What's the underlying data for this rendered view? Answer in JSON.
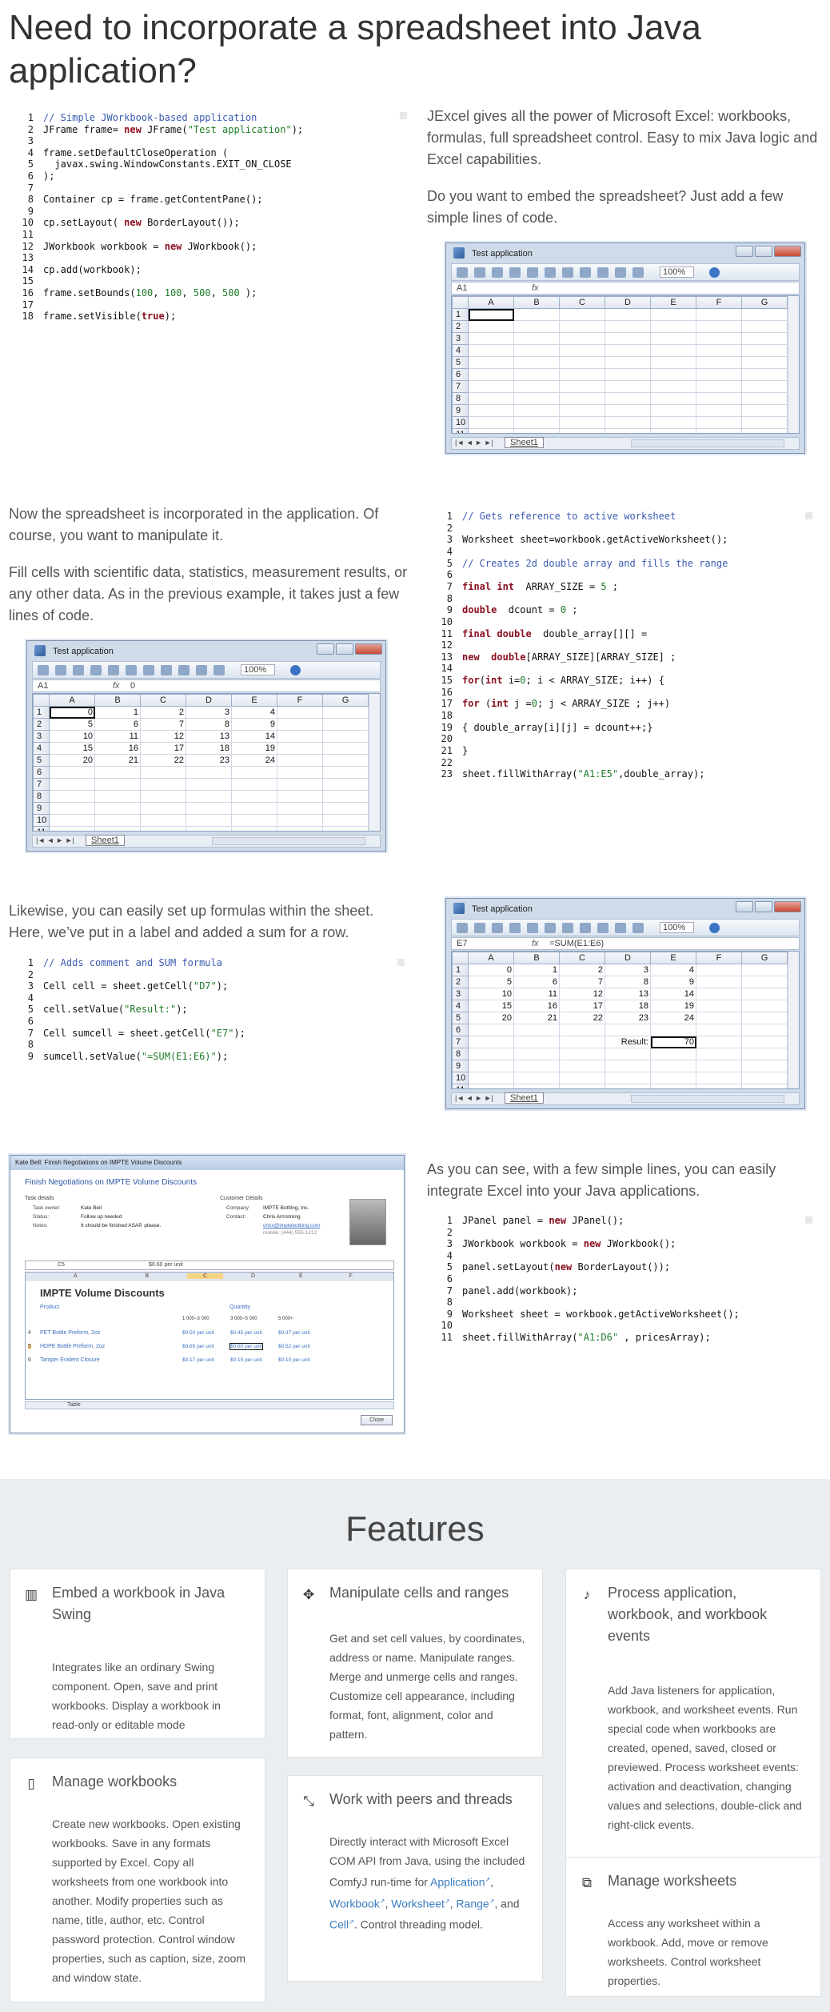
{
  "page_title": "Need to incorporate a spreadsheet into Java application?",
  "s1": {
    "code": [
      {
        "n": "1",
        "parts": [
          [
            "c-com",
            "// Simple JWorkbook-based application"
          ]
        ]
      },
      {
        "n": "2",
        "parts": [
          [
            "",
            "JFrame frame= "
          ],
          [
            "c-kw",
            "new"
          ],
          [
            "",
            " JFrame("
          ],
          [
            "c-str",
            "\"Test application\""
          ],
          [
            "",
            ");"
          ]
        ]
      },
      {
        "n": "3",
        "parts": []
      },
      {
        "n": "4",
        "parts": [
          [
            "",
            "frame.setDefaultCloseOperation ("
          ]
        ]
      },
      {
        "n": "5",
        "parts": [
          [
            "",
            "  javax.swing.WindowConstants.EXIT_ON_CLOSE"
          ]
        ]
      },
      {
        "n": "6",
        "parts": [
          [
            "",
            ");"
          ]
        ]
      },
      {
        "n": "7",
        "parts": []
      },
      {
        "n": "8",
        "parts": [
          [
            "",
            "Container cp = frame.getContentPane();"
          ]
        ]
      },
      {
        "n": "9",
        "parts": []
      },
      {
        "n": "10",
        "parts": [
          [
            "",
            "cp.setLayout( "
          ],
          [
            "c-kw",
            "new"
          ],
          [
            "",
            " BorderLayout());"
          ]
        ]
      },
      {
        "n": "11",
        "parts": []
      },
      {
        "n": "12",
        "parts": [
          [
            "",
            "JWorkbook workbook = "
          ],
          [
            "c-kw",
            "new"
          ],
          [
            "",
            " JWorkbook();"
          ]
        ]
      },
      {
        "n": "13",
        "parts": []
      },
      {
        "n": "14",
        "parts": [
          [
            "",
            "cp.add(workbook);"
          ]
        ]
      },
      {
        "n": "15",
        "parts": []
      },
      {
        "n": "16",
        "parts": [
          [
            "",
            "frame.setBounds("
          ],
          [
            "c-num",
            "100"
          ],
          [
            "",
            ", "
          ],
          [
            "c-num",
            "100"
          ],
          [
            "",
            ", "
          ],
          [
            "c-num",
            "500"
          ],
          [
            "",
            ", "
          ],
          [
            "c-num",
            "500"
          ],
          [
            "",
            " );"
          ]
        ]
      },
      {
        "n": "17",
        "parts": []
      },
      {
        "n": "18",
        "parts": [
          [
            "",
            "frame.setVisible("
          ],
          [
            "c-kw",
            "true"
          ],
          [
            "",
            ");"
          ]
        ]
      }
    ],
    "p1": "JExcel gives all the power of Microsoft Excel: workbooks, formulas, full spreadsheet control. Easy to mix Java logic and Excel capabilities.",
    "p2": "Do you want to embed the spreadsheet? Just add a few simple lines of code."
  },
  "win1": {
    "title": "Test application",
    "cellref": "A1",
    "fx": "fx",
    "formula": "",
    "zoom": "100%",
    "sheet": "Sheet1",
    "cols": [
      "A",
      "B",
      "C",
      "D",
      "E",
      "F",
      "G"
    ],
    "rows": [
      [
        "1",
        "",
        "",
        "",
        "",
        "",
        "",
        ""
      ],
      [
        "2",
        "",
        "",
        "",
        "",
        "",
        "",
        ""
      ],
      [
        "3",
        "",
        "",
        "",
        "",
        "",
        "",
        ""
      ],
      [
        "4",
        "",
        "",
        "",
        "",
        "",
        "",
        ""
      ],
      [
        "5",
        "",
        "",
        "",
        "",
        "",
        "",
        ""
      ],
      [
        "6",
        "",
        "",
        "",
        "",
        "",
        "",
        ""
      ],
      [
        "7",
        "",
        "",
        "",
        "",
        "",
        "",
        ""
      ],
      [
        "8",
        "",
        "",
        "",
        "",
        "",
        "",
        ""
      ],
      [
        "9",
        "",
        "",
        "",
        "",
        "",
        "",
        ""
      ],
      [
        "10",
        "",
        "",
        "",
        "",
        "",
        "",
        ""
      ],
      [
        "11",
        "",
        "",
        "",
        "",
        "",
        "",
        ""
      ]
    ]
  },
  "s2": {
    "p1": "Now the spreadsheet is incorporated in the application. Of course, you want to manipulate it.",
    "p2": "Fill cells with scientific data, statistics, measurement results, or any other data. As in the previous example, it takes just a few lines of code.",
    "code": [
      {
        "n": "1",
        "parts": [
          [
            "c-com",
            "// Gets reference to active worksheet"
          ]
        ]
      },
      {
        "n": "2",
        "parts": []
      },
      {
        "n": "3",
        "parts": [
          [
            "",
            "Worksheet sheet=workbook.getActiveWorksheet();"
          ]
        ]
      },
      {
        "n": "4",
        "parts": []
      },
      {
        "n": "5",
        "parts": [
          [
            "c-com",
            "// Creates 2d double array and fills the range"
          ]
        ]
      },
      {
        "n": "6",
        "parts": []
      },
      {
        "n": "7",
        "parts": [
          [
            "c-kw",
            "final int"
          ],
          [
            "",
            "  ARRAY_SIZE = "
          ],
          [
            "c-num",
            "5"
          ],
          [
            "",
            " ;"
          ]
        ]
      },
      {
        "n": "8",
        "parts": []
      },
      {
        "n": "9",
        "parts": [
          [
            "c-kw",
            "double"
          ],
          [
            "",
            "  dcount = "
          ],
          [
            "c-num",
            "0"
          ],
          [
            "",
            " ;"
          ]
        ]
      },
      {
        "n": "10",
        "parts": []
      },
      {
        "n": "11",
        "parts": [
          [
            "c-kw",
            "final double"
          ],
          [
            "",
            "  double_array[][] ="
          ]
        ]
      },
      {
        "n": "12",
        "parts": []
      },
      {
        "n": "13",
        "parts": [
          [
            "c-kw",
            "new"
          ],
          [
            "",
            "  "
          ],
          [
            "c-kw",
            "double"
          ],
          [
            "",
            "[ARRAY_SIZE][ARRAY_SIZE] ;"
          ]
        ]
      },
      {
        "n": "14",
        "parts": []
      },
      {
        "n": "15",
        "parts": [
          [
            "c-kw",
            "for"
          ],
          [
            "",
            "("
          ],
          [
            "c-kw",
            "int"
          ],
          [
            "",
            " i="
          ],
          [
            "c-num",
            "0"
          ],
          [
            "",
            "; i < ARRAY_SIZE; i++) {"
          ]
        ]
      },
      {
        "n": "16",
        "parts": []
      },
      {
        "n": "17",
        "parts": [
          [
            "c-kw",
            "for"
          ],
          [
            "",
            " ("
          ],
          [
            "c-kw",
            "int"
          ],
          [
            "",
            " j ="
          ],
          [
            "c-num",
            "0"
          ],
          [
            "",
            "; j < ARRAY_SIZE ; j++)"
          ]
        ]
      },
      {
        "n": "18",
        "parts": []
      },
      {
        "n": "19",
        "parts": [
          [
            "",
            "{ double_array[i][j] = dcount++;}"
          ]
        ]
      },
      {
        "n": "20",
        "parts": []
      },
      {
        "n": "21",
        "parts": [
          [
            "",
            "}"
          ]
        ]
      },
      {
        "n": "22",
        "parts": []
      },
      {
        "n": "23",
        "parts": [
          [
            "",
            "sheet.fillWithArray("
          ],
          [
            "c-str",
            "\"A1:E5\""
          ],
          [
            "",
            ",double_array);"
          ]
        ]
      }
    ]
  },
  "win2": {
    "title": "Test application",
    "cellref": "A1",
    "fx": "fx",
    "formula": "0",
    "zoom": "100%",
    "sheet": "Sheet1",
    "cols": [
      "A",
      "B",
      "C",
      "D",
      "E",
      "F",
      "G"
    ],
    "rows": [
      [
        "1",
        "0",
        "1",
        "2",
        "3",
        "4",
        "",
        ""
      ],
      [
        "2",
        "5",
        "6",
        "7",
        "8",
        "9",
        "",
        ""
      ],
      [
        "3",
        "10",
        "11",
        "12",
        "13",
        "14",
        "",
        ""
      ],
      [
        "4",
        "15",
        "16",
        "17",
        "18",
        "19",
        "",
        ""
      ],
      [
        "5",
        "20",
        "21",
        "22",
        "23",
        "24",
        "",
        ""
      ],
      [
        "6",
        "",
        "",
        "",
        "",
        "",
        "",
        ""
      ],
      [
        "7",
        "",
        "",
        "",
        "",
        "",
        "",
        ""
      ],
      [
        "8",
        "",
        "",
        "",
        "",
        "",
        "",
        ""
      ],
      [
        "9",
        "",
        "",
        "",
        "",
        "",
        "",
        ""
      ],
      [
        "10",
        "",
        "",
        "",
        "",
        "",
        "",
        ""
      ],
      [
        "11",
        "",
        "",
        "",
        "",
        "",
        "",
        ""
      ]
    ]
  },
  "s3": {
    "p1": "Likewise, you can easily set up formulas within the sheet. Here, we’ve put in a label and added a sum for a row.",
    "code": [
      {
        "n": "1",
        "parts": [
          [
            "c-com",
            "// Adds comment and SUM formula"
          ]
        ]
      },
      {
        "n": "2",
        "parts": []
      },
      {
        "n": "3",
        "parts": [
          [
            "",
            "Cell cell = sheet.getCell("
          ],
          [
            "c-str",
            "\"D7\""
          ],
          [
            "",
            ");"
          ]
        ]
      },
      {
        "n": "4",
        "parts": []
      },
      {
        "n": "5",
        "parts": [
          [
            "",
            "cell.setValue("
          ],
          [
            "c-str",
            "\"Result:\""
          ],
          [
            "",
            ");"
          ]
        ]
      },
      {
        "n": "6",
        "parts": []
      },
      {
        "n": "7",
        "parts": [
          [
            "",
            "Cell sumcell = sheet.getCell("
          ],
          [
            "c-str",
            "\"E7\""
          ],
          [
            "",
            ");"
          ]
        ]
      },
      {
        "n": "8",
        "parts": []
      },
      {
        "n": "9",
        "parts": [
          [
            "",
            "sumcell.setValue("
          ],
          [
            "c-str",
            "\"=SUM(E1:E6)\""
          ],
          [
            "",
            ");"
          ]
        ]
      }
    ]
  },
  "win3": {
    "title": "Test application",
    "cellref": "E7",
    "fx": "fx",
    "formula": "=SUM(E1:E6)",
    "zoom": "100%",
    "sheet": "Sheet1",
    "cols": [
      "A",
      "B",
      "C",
      "D",
      "E",
      "F",
      "G"
    ],
    "rows": [
      [
        "1",
        "0",
        "1",
        "2",
        "3",
        "4",
        "",
        ""
      ],
      [
        "2",
        "5",
        "6",
        "7",
        "8",
        "9",
        "",
        ""
      ],
      [
        "3",
        "10",
        "11",
        "12",
        "13",
        "14",
        "",
        ""
      ],
      [
        "4",
        "15",
        "16",
        "17",
        "18",
        "19",
        "",
        ""
      ],
      [
        "5",
        "20",
        "21",
        "22",
        "23",
        "24",
        "",
        ""
      ],
      [
        "6",
        "",
        "",
        "",
        "",
        "",
        "",
        ""
      ],
      [
        "7",
        "",
        "",
        "",
        "Result:",
        "70",
        "",
        ""
      ],
      [
        "8",
        "",
        "",
        "",
        "",
        "",
        "",
        ""
      ],
      [
        "9",
        "",
        "",
        "",
        "",
        "",
        "",
        ""
      ],
      [
        "10",
        "",
        "",
        "",
        "",
        "",
        "",
        ""
      ],
      [
        "11",
        "",
        "",
        "",
        "",
        "",
        "",
        ""
      ]
    ]
  },
  "s4": {
    "p1": "As you can see, with a few simple lines, you can easily integrate Excel into your Java applications.",
    "code": [
      {
        "n": "1",
        "parts": [
          [
            "",
            "JPanel panel = "
          ],
          [
            "c-kw",
            "new"
          ],
          [
            "",
            " JPanel();"
          ]
        ]
      },
      {
        "n": "2",
        "parts": []
      },
      {
        "n": "3",
        "parts": [
          [
            "",
            "JWorkbook workbook = "
          ],
          [
            "c-kw",
            "new"
          ],
          [
            "",
            " JWorkbook();"
          ]
        ]
      },
      {
        "n": "4",
        "parts": []
      },
      {
        "n": "5",
        "parts": [
          [
            "",
            "panel.setLayout("
          ],
          [
            "c-kw",
            "new"
          ],
          [
            "",
            " BorderLayout());"
          ]
        ]
      },
      {
        "n": "6",
        "parts": []
      },
      {
        "n": "7",
        "parts": [
          [
            "",
            "panel.add(workbook);"
          ]
        ]
      },
      {
        "n": "8",
        "parts": []
      },
      {
        "n": "9",
        "parts": [
          [
            "",
            "Worksheet sheet = workbook.getActiveWorksheet();"
          ]
        ]
      },
      {
        "n": "10",
        "parts": []
      },
      {
        "n": "11",
        "parts": [
          [
            "",
            "sheet.fillWithArray("
          ],
          [
            "c-str",
            "\"A1:D6\""
          ],
          [
            "",
            " , pricesArray);"
          ]
        ]
      }
    ]
  },
  "outlook": {
    "title": "Kate Bell: Finish Negotiations on IMPTE Volume Discounts",
    "heading": "Finish Negotiations on IMPTE Volume Discounts",
    "task_details": "Task details",
    "customer_details": "Customer Details",
    "owner_label": "Task owner:",
    "owner": "Kate Bell",
    "status_label": "Status:",
    "status": "Follow up needed",
    "notes_label": "Notes:",
    "notes": "It should be finished ASAP, please.",
    "company_label": "Company:",
    "company": "IMPTE Bottling, Inc.",
    "contact_label": "Contact:",
    "contact": "Chris Armstrong",
    "email": "chris@imptebottling.com",
    "mobile": "mobile: (444) 555-1212",
    "cellref": "C5",
    "formula": "$0.60 per unit",
    "sheet_title": "IMPTE Volume Discounts",
    "product": "Product",
    "quantity": "Quantity",
    "q1": "1 000−3 000",
    "q2": "3 000−5 000",
    "q3": "5 000+",
    "items": [
      [
        "4",
        "PET Bottle Preform, 2oz",
        "$0.50 per unit",
        "$0.45 per unit",
        "$0.37 per unit"
      ],
      [
        "5",
        "HDPE Bottle Preform, 2oz",
        "$0.65 per unit",
        "$0.60 per unit",
        "$0.52 per unit"
      ],
      [
        "6",
        "Tamper Evident Closure",
        "$0.17 per unit",
        "$0.15 per unit",
        "$0.10 per unit"
      ]
    ],
    "sheet_tab": "Table",
    "close": "Close",
    "cols": [
      "A",
      "B",
      "C",
      "D",
      "E",
      "F"
    ]
  },
  "features": {
    "title": "Features",
    "cards": [
      {
        "icon": "building-icon",
        "title": "Embed a workbook in Java Swing",
        "body": "Integrates like an ordinary Swing component. Open, save and print workbooks. Display a workbook in read-only or editable mode"
      },
      {
        "icon": "move-arrows-icon",
        "title": "Manipulate cells and ranges",
        "body": "Get and set cell values, by coordinates, address or name. Manipulate ranges. Merge and unmerge cells and ranges. Customize cell appearance, including format, font, alignment, color and pattern."
      },
      {
        "icon": "bell-icon",
        "title": "Process application, workbook, and workbook events",
        "body": "Add Java listeners for application, workbook, and worksheet events. Run special code when workbooks are created, opened, saved, closed or previewed. Process worksheet events: activation and deactivation, changing values and selections, double-click and right-click events."
      },
      {
        "icon": "book-icon",
        "title": "Manage workbooks",
        "body": "Create new workbooks. Open existing workbooks. Save in any formats supported by Excel. Copy all worksheets from one workbook into another. Modify properties such as name, title, author, etc. Control password protection. Control window properties, such as caption, size, zoom and window state."
      },
      {
        "icon": "compress-arrows-icon",
        "title": "Work with peers and threads",
        "body_pre": "Directly interact with Microsoft Excel COM API from Java, using the included ComfyJ run-time for ",
        "links": [
          "Application",
          "Workbook",
          "Worksheet",
          "Range",
          "Cell"
        ],
        "body_post": ". Control threading model."
      },
      {
        "icon": "open-book-icon",
        "title": "Manage worksheets",
        "body": "Access any worksheet within a workbook. Add, move or remove worksheets. Control worksheet properties."
      }
    ]
  }
}
